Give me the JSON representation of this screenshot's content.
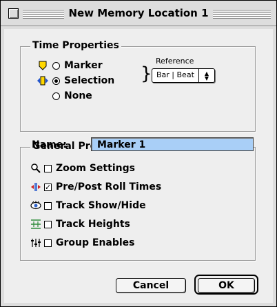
{
  "window": {
    "title": "New Memory Location 1"
  },
  "time_properties": {
    "heading": "Time Properties",
    "options": [
      {
        "label": "Marker",
        "selected": false
      },
      {
        "label": "Selection",
        "selected": true
      },
      {
        "label": "None",
        "selected": false
      }
    ],
    "reference_label": "Reference",
    "reference_value": "Bar | Beat"
  },
  "general_properties": {
    "heading": "General Properties",
    "name_label": "Name:",
    "name_value": "Marker 1",
    "checkboxes": [
      {
        "label": "Zoom Settings",
        "checked": false,
        "icon": "magnifier-icon"
      },
      {
        "label": "Pre/Post Roll Times",
        "checked": true,
        "icon": "pre-post-roll-icon"
      },
      {
        "label": "Track Show/Hide",
        "checked": false,
        "icon": "eye-icon"
      },
      {
        "label": "Track Heights",
        "checked": false,
        "icon": "track-heights-icon"
      },
      {
        "label": "Group Enables",
        "checked": false,
        "icon": "group-faders-icon"
      }
    ]
  },
  "buttons": {
    "cancel": "Cancel",
    "ok": "OK"
  },
  "colors": {
    "name_field_bg": "#a9cff7",
    "marker_icon": "#ffd700",
    "selection_icon": "#2255cc",
    "preroll_icon": "#cc2222",
    "track_heights_icon": "#2e8b3a"
  }
}
